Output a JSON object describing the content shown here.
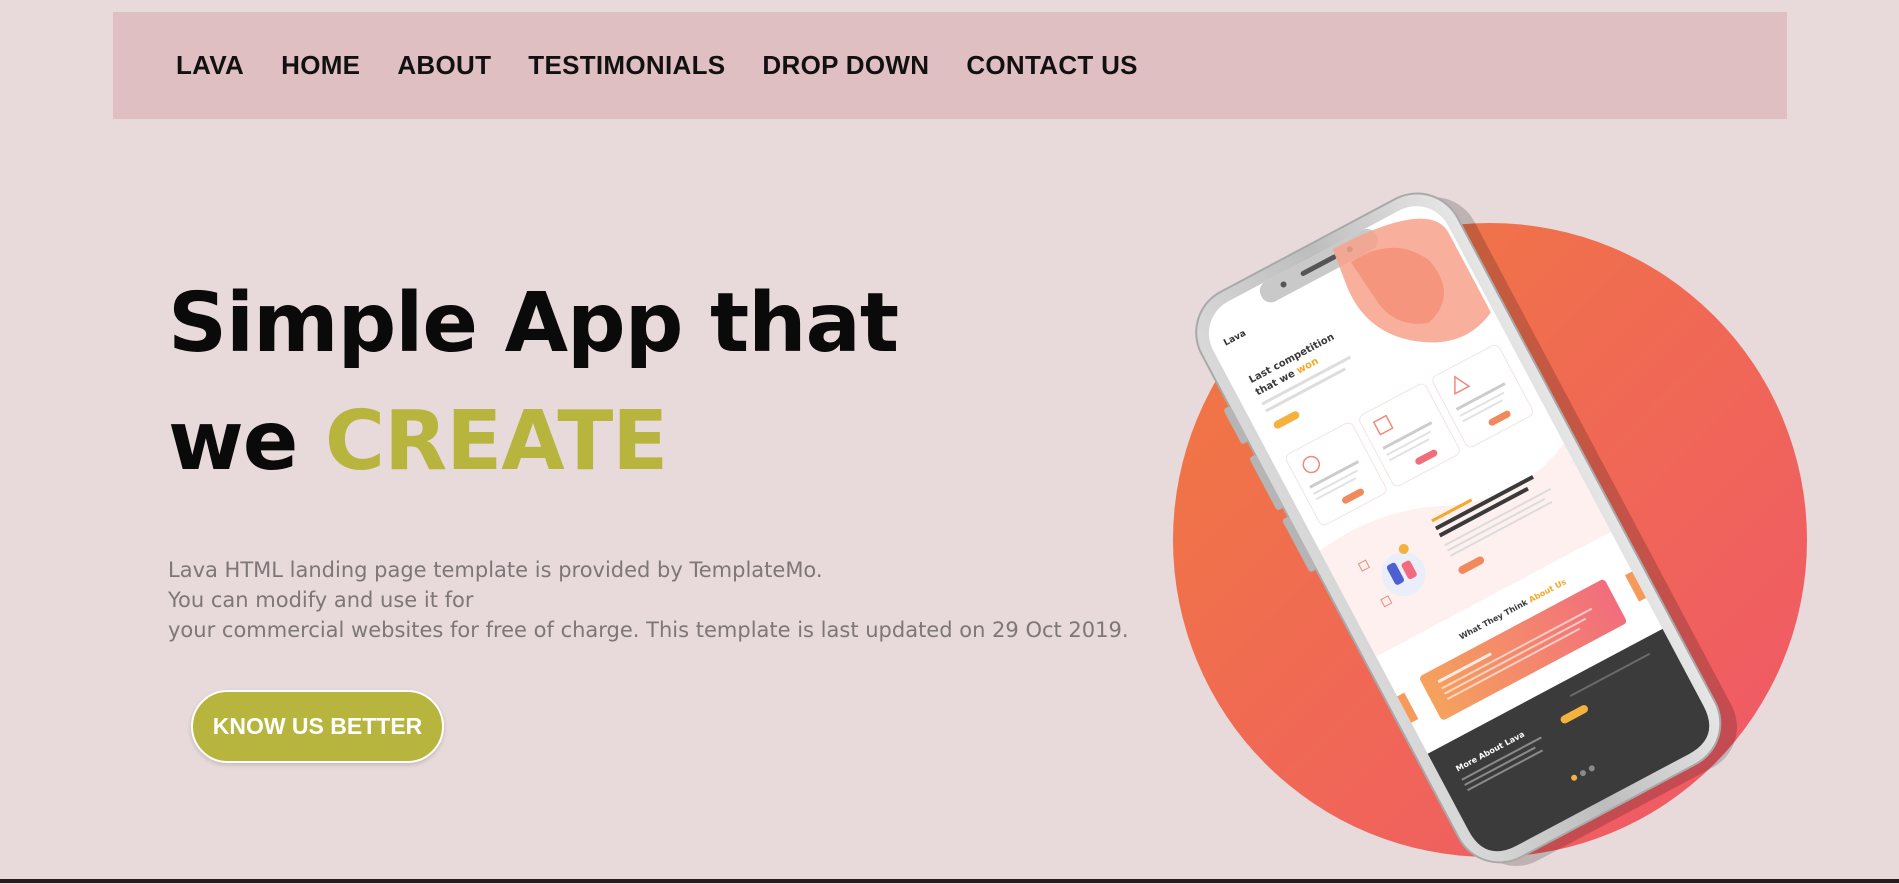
{
  "nav": {
    "items": [
      {
        "label": "LAVA"
      },
      {
        "label": "HOME"
      },
      {
        "label": "ABOUT"
      },
      {
        "label": "TESTIMONIALS"
      },
      {
        "label": "DROP DOWN"
      },
      {
        "label": "CONTACT US"
      }
    ]
  },
  "hero": {
    "title_line1": "Simple App that",
    "title_line2_prefix": "we ",
    "title_line2_highlight": "CREATE",
    "description_lines": [
      "Lava HTML landing page template is provided by TemplateMo.",
      "You can modify and use it for",
      "your commercial websites for free of charge. This template is last updated on 29 Oct 2019."
    ],
    "cta_label": "KNOW US BETTER"
  },
  "phone_screen": {
    "brand": "Lava",
    "headline": "Last competition that we won",
    "section_title": "What They Think About Us",
    "footer_title": "More About Lava"
  },
  "colors": {
    "background": "#e8d9da",
    "navbar": "#e0bfc2",
    "accent": "#b7b53d",
    "circle_start": "#f07b3f",
    "circle_end": "#f0566a"
  },
  "icons": {
    "hero_image": "phone-mockup-illustration"
  }
}
